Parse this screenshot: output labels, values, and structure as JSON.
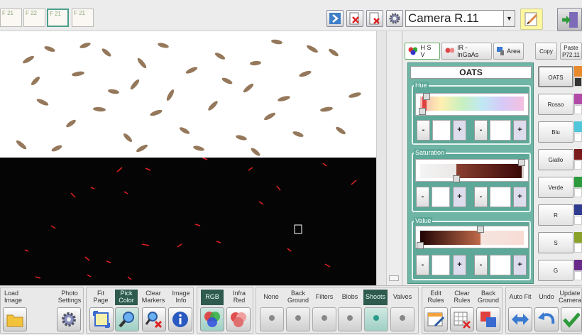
{
  "toolbar": {
    "thumbnails": [
      "F 21",
      "F 22",
      "F 21",
      "F 21"
    ],
    "camera_value": "Camera  R.11"
  },
  "tabs": {
    "hsv": "H S V",
    "ir": "IR - InGaAs",
    "area": "Area",
    "copy": "Copy",
    "paste": "Paste",
    "paste_sub": "P72.11"
  },
  "profile": {
    "name": "OATS",
    "hue_label": "Hue",
    "saturation_label": "Saturation",
    "value_label": "Value",
    "hue_range": {
      "min": 0.02,
      "max": 0.06
    },
    "saturation_range": {
      "min": 0.35,
      "max": 0.98
    },
    "value_range": {
      "min": 0.0,
      "max": 0.58
    }
  },
  "presets": [
    {
      "label": "OATS",
      "color": "#e98a2c"
    },
    {
      "label": "Rosso",
      "color": "#b24aa7"
    },
    {
      "label": "Blu",
      "color": "#4fc6d9"
    },
    {
      "label": "Giallo",
      "color": "#7a1a1a"
    },
    {
      "label": "Verde",
      "color": "#2a9a3a"
    },
    {
      "label": "R",
      "color": "#2f3b8f"
    },
    {
      "label": "S",
      "color": "#8aa12a"
    },
    {
      "label": "G",
      "color": "#6a2a8a"
    }
  ],
  "bottom": {
    "load_image": "Load\nImage",
    "photo_settings": "Photo\nSettings",
    "fit_page": "Fit\nPage",
    "pick_color": "Pick\nColor",
    "clear_markers": "Clear\nMarkers",
    "image_info": "Image\nInfo",
    "rgb": "RGB",
    "infra_red": "Infra\nRed",
    "none": "None",
    "background": "Back\nGround",
    "filters": "Filters",
    "blobs": "Blobs",
    "shoots": "Shoots",
    "valves": "Valves",
    "edit_rules": "Edit\nRules",
    "clear_rules": "Clear\nRules",
    "back_ground2": "Back\nGround",
    "auto_fit": "Auto Fit",
    "undo": "Undo",
    "update_camera": "Update\nCamera"
  }
}
